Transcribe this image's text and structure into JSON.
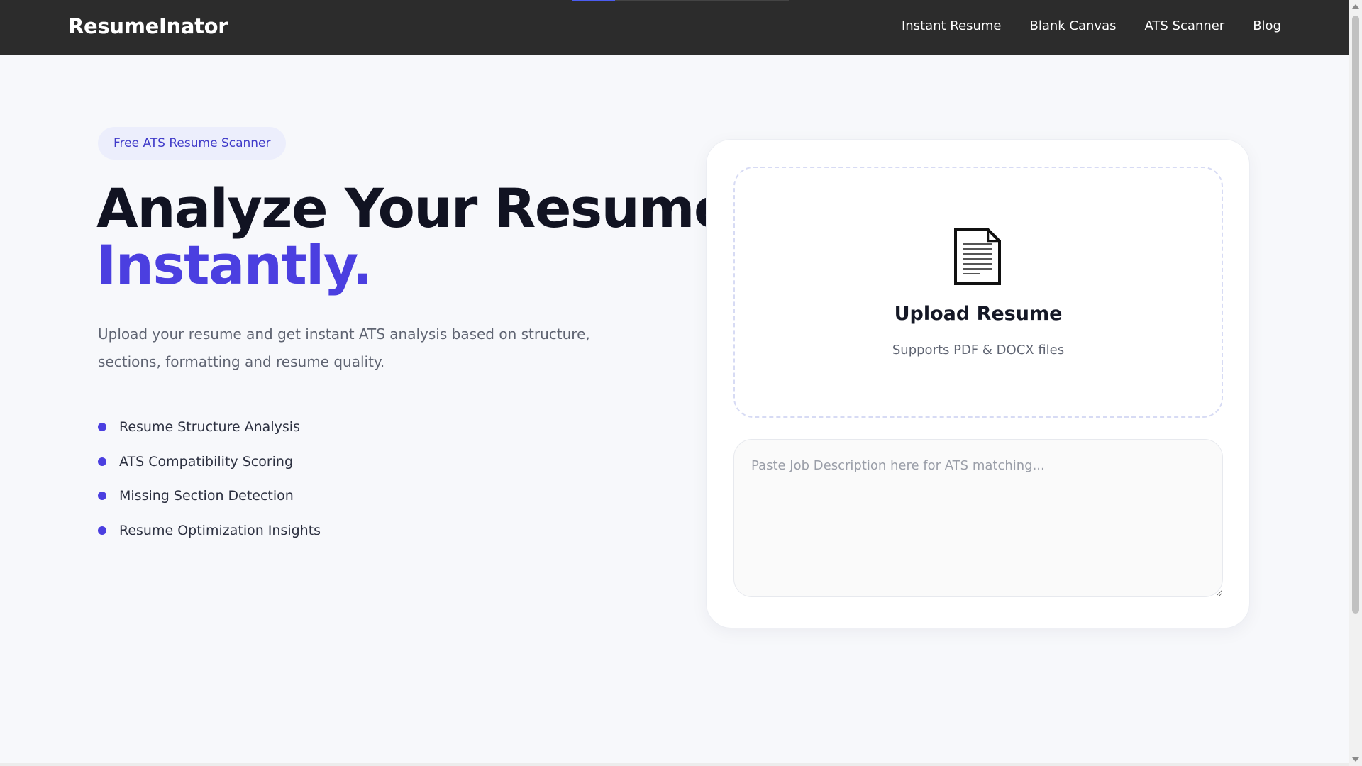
{
  "header": {
    "brand": "ResumeInator",
    "nav": [
      "Instant Resume",
      "Blank Canvas",
      "ATS Scanner",
      "Blog"
    ],
    "loading_progress": 0.2
  },
  "hero": {
    "badge": "Free ATS Resume Scanner",
    "headline_line1": "Analyze Your Resume",
    "headline_line2": "Instantly.",
    "description": "Upload your resume and get instant ATS analysis based on structure, sections, formatting and resume quality.",
    "features": [
      "Resume Structure Analysis",
      "ATS Compatibility Scoring",
      "Missing Section Detection",
      "Resume Optimization Insights"
    ]
  },
  "upload": {
    "icon": "document-icon",
    "title": "Upload Resume",
    "subtitle": "Supports PDF & DOCX files"
  },
  "job_description": {
    "placeholder": "Paste Job Description here for ATS matching..."
  },
  "colors": {
    "accent": "#4b3fe0",
    "header_bg": "#2c2c2c",
    "badge_bg": "#eceefc"
  }
}
